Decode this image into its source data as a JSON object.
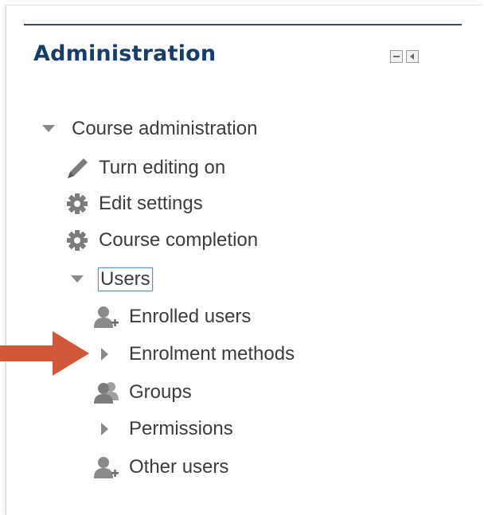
{
  "block": {
    "title": "Administration"
  },
  "tree": {
    "course_admin": "Course administration",
    "turn_editing": "Turn editing on",
    "edit_settings": "Edit settings",
    "course_completion": "Course completion",
    "users": "Users",
    "enrolled_users": "Enrolled users",
    "enrolment_methods": "Enrolment methods",
    "groups": "Groups",
    "permissions": "Permissions",
    "other_users": "Other users"
  },
  "colors": {
    "title": "#173e68",
    "text": "#3c3c3c",
    "icon": "#808080",
    "highlight_arrow": "#d0573a"
  },
  "icons": [
    "triangle-down-icon",
    "pencil-icon",
    "gear-icon",
    "user-add-icon",
    "triangle-right-icon",
    "group-icon",
    "dock-icon",
    "hide-icon"
  ]
}
